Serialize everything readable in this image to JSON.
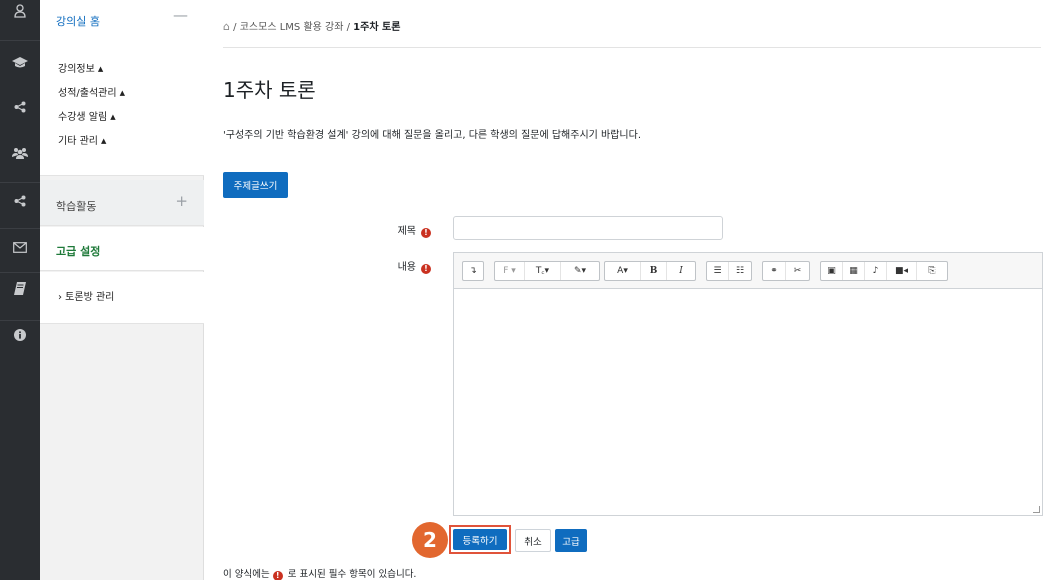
{
  "rail": {
    "icons": [
      "user-icon",
      "graduation-cap-icon",
      "share-icon",
      "users-icon",
      "share-icon",
      "envelope-icon",
      "book-icon",
      "info-icon"
    ]
  },
  "nav": {
    "home": "강의실 홈",
    "home_toggle": "—",
    "sub_items": [
      "강의정보",
      "성적/출석관리",
      "수강생 알림",
      "기타 관리"
    ],
    "caret": "▲",
    "activities": "학습활동",
    "activities_toggle": "+",
    "advanced_settings": "고급 설정",
    "forum_manage": "› 토론방 관리"
  },
  "breadcrumb": {
    "sep": "/",
    "course": "코스모스 LMS 활용 강좌",
    "current": "1주차 토론"
  },
  "page": {
    "title": "1주차 토론",
    "intro": "'구성주의 기반 학습환경 설계' 강의에 대해 질문을 올리고, 다른 학생의 질문에 답해주시기 바랍니다.",
    "new_topic_button": "주제글쓰기"
  },
  "form": {
    "subject_label": "제목",
    "content_label": "내용",
    "required_mark": "!",
    "toolbar": {
      "expand": "↴",
      "font": "F ▾",
      "size": "T꜀▾",
      "color": "✎▾",
      "style": "A▾",
      "bold": "B",
      "italic": "I",
      "ul": "☰",
      "ol": "☷",
      "link": "⚭",
      "unlink": "✂",
      "image": "▣",
      "media": "▦",
      "mic": "♪",
      "video": "■◂",
      "copy": "⎘"
    },
    "submit_button": "등록하기",
    "cancel_button": "취소",
    "advanced_button": "고급",
    "step_badge": "2",
    "required_note_before": "이 양식에는",
    "required_note_after": "로 표시된 필수 항목이 있습니다."
  }
}
